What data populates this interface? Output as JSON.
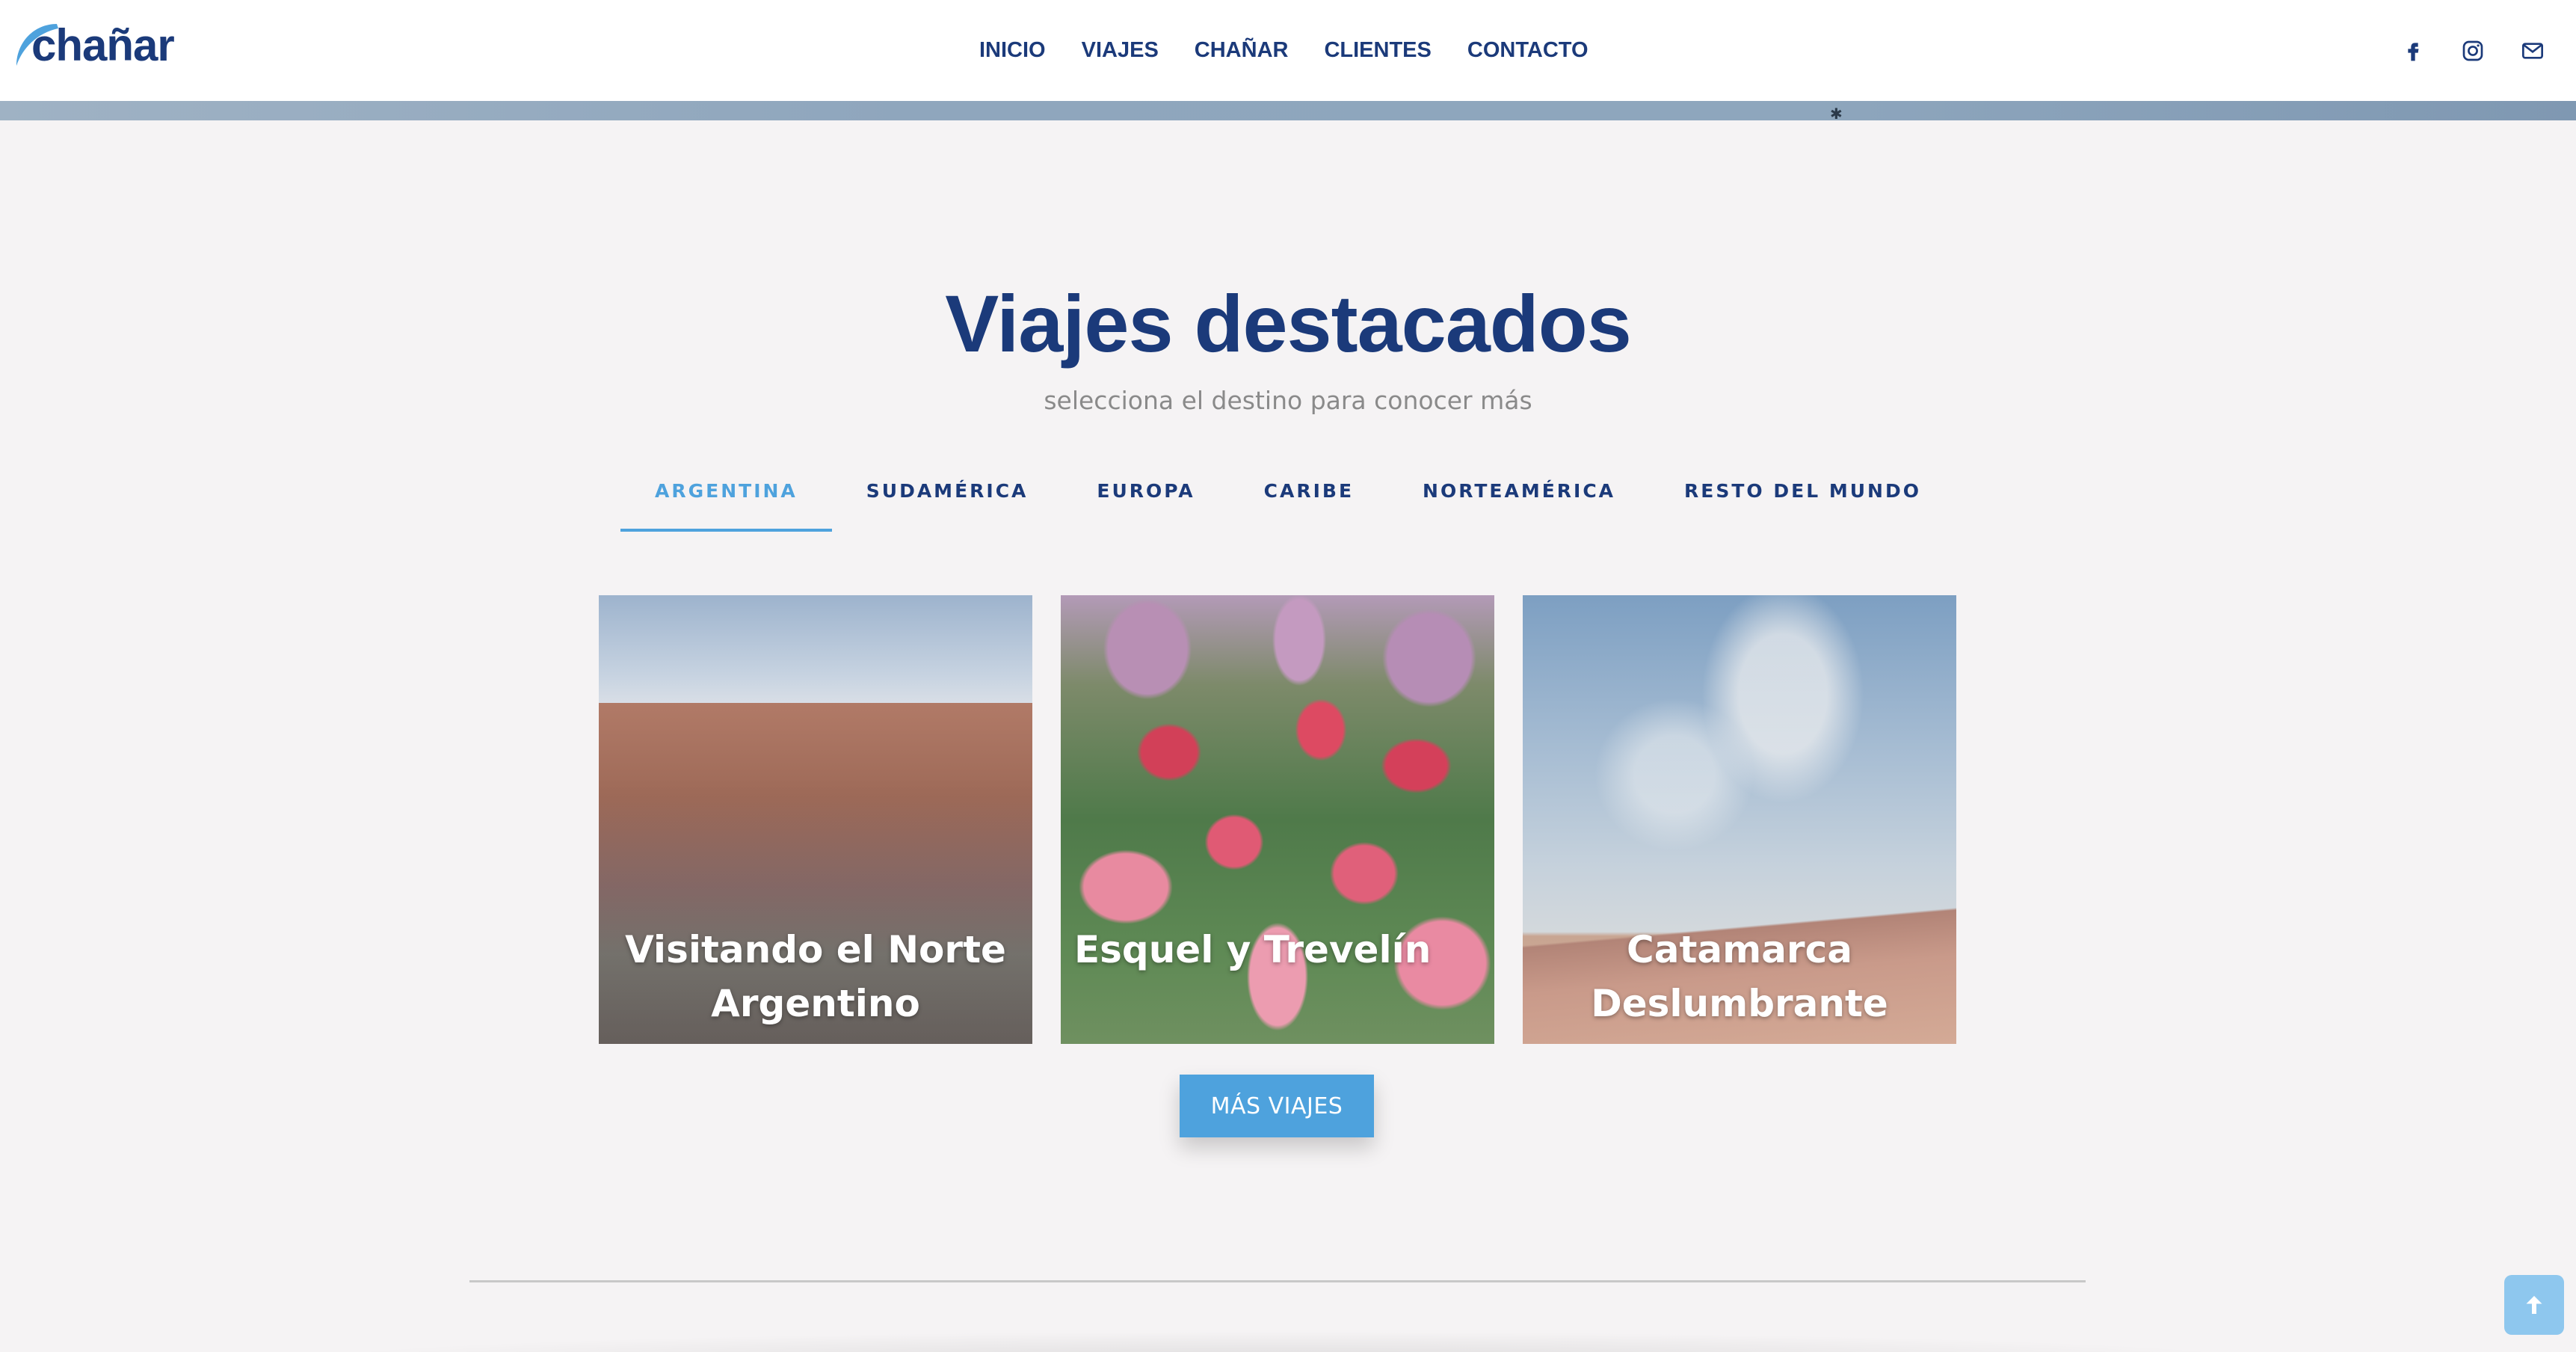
{
  "header": {
    "logo_text": "chañar",
    "nav": [
      {
        "label": "INICIO"
      },
      {
        "label": "VIAJES"
      },
      {
        "label": "CHAÑAR"
      },
      {
        "label": "CLIENTES"
      },
      {
        "label": "CONTACTO"
      }
    ],
    "social": [
      "facebook-icon",
      "instagram-icon",
      "envelope-icon"
    ]
  },
  "section": {
    "title": "Viajes destacados",
    "subtitle": "selecciona el destino para conocer más",
    "tabs": [
      {
        "label": "ARGENTINA",
        "active": true
      },
      {
        "label": "SUDAMÉRICA",
        "active": false
      },
      {
        "label": "EUROPA",
        "active": false
      },
      {
        "label": "CARIBE",
        "active": false
      },
      {
        "label": "NORTEAMÉRICA",
        "active": false
      },
      {
        "label": "RESTO DEL MUNDO",
        "active": false
      }
    ],
    "cards": [
      {
        "title": "Visitando el Norte Argentino"
      },
      {
        "title": "Esquel y Trevelín"
      },
      {
        "title": "Catamarca Deslumbrante"
      }
    ],
    "more_button": "MÁS VIAJES"
  },
  "colors": {
    "brand_navy": "#1b3a7a",
    "accent_blue": "#4ea2dd",
    "background": "#f5f3f4"
  }
}
